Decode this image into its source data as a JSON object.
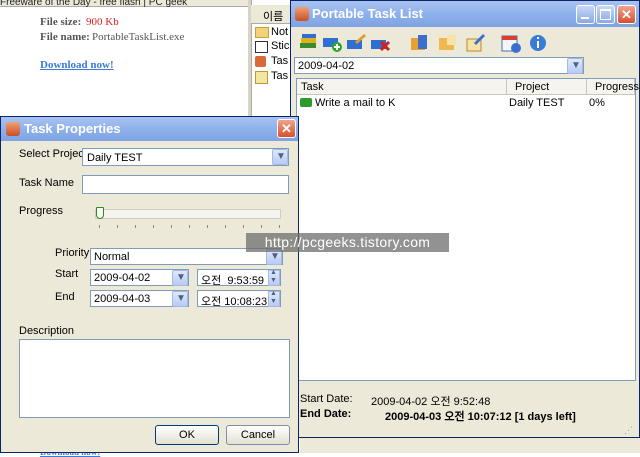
{
  "background_page": {
    "top_text": "Freeware of the Day - free flash   |   PC geek",
    "file_size_label": "File size:",
    "file_size_value": "900 Kb",
    "file_name_label": "File name:",
    "file_name_value": "PortableTaskList.exe",
    "download_link": "Download now!",
    "bottom_text": "Download now!"
  },
  "explorer": {
    "header": "이름",
    "items": [
      "Not",
      "Stic",
      "Tas",
      "Tas"
    ]
  },
  "main_window": {
    "title": "Portable Task List",
    "toolbar_icons": [
      "books-icon",
      "add-task-icon",
      "edit-task-icon",
      "delete-task-icon",
      "folder-icon",
      "folder-edit-icon",
      "properties-icon",
      "calendar-icon",
      "info-icon"
    ],
    "date_combo_value": "2009-04-02",
    "columns": [
      "Task",
      "Project",
      "Progress"
    ],
    "rows": [
      {
        "task": "Write a mail to K",
        "project": "Daily TEST",
        "progress": "0%"
      }
    ],
    "start_date_label": "Start Date:",
    "start_date_value": "2009-04-02 오전 9:52:48",
    "end_date_label": "End Date:",
    "end_date_value": "2009-04-03 오전 10:07:12 [1 days left]"
  },
  "dialog": {
    "title": "Task Properties",
    "select_project_label": "Select Project",
    "select_project_value": "Daily TEST",
    "task_name_label": "Task Name",
    "task_name_value": "",
    "progress_label": "Progress",
    "progress_value": 0,
    "priority_label": "Priority",
    "priority_value": "Normal",
    "start_label": "Start",
    "start_date": "2009-04-02",
    "start_time": "오전  9:53:59",
    "end_label": "End",
    "end_date": "2009-04-03",
    "end_time": "오전 10:08:23",
    "description_label": "Description",
    "description_value": "",
    "ok_label": "OK",
    "cancel_label": "Cancel"
  },
  "watermark": "http://pcgeeks.tistory.com"
}
